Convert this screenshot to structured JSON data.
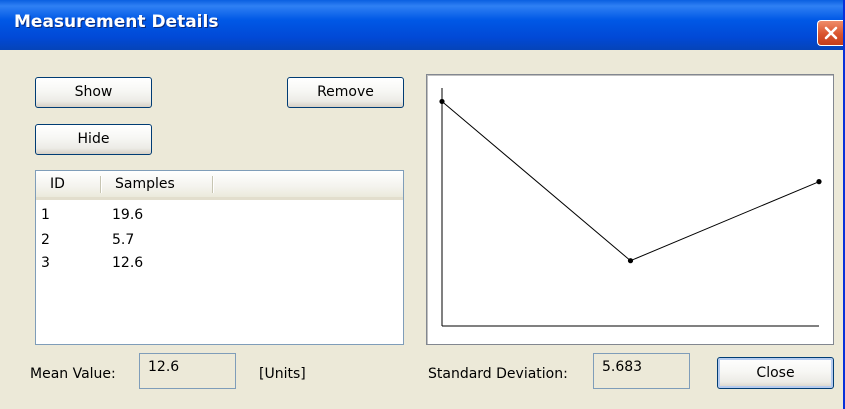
{
  "window": {
    "title": "Measurement Details"
  },
  "buttons": {
    "show": "Show",
    "remove": "Remove",
    "hide": "Hide",
    "close": "Close"
  },
  "table": {
    "columns": [
      "ID",
      "Samples"
    ],
    "rows": [
      {
        "id": "1",
        "sample": "19.6"
      },
      {
        "id": "2",
        "sample": "5.7"
      },
      {
        "id": "3",
        "sample": "12.6"
      }
    ]
  },
  "stats": {
    "mean_label": "Mean Value:",
    "mean_value": "12.6",
    "units_label": "[Units]",
    "std_label": "Standard Deviation:",
    "std_value": "5.683"
  },
  "chart_data": {
    "type": "line",
    "x": [
      1,
      2,
      3
    ],
    "series": [
      {
        "values": [
          19.6,
          5.7,
          12.6
        ]
      }
    ],
    "xlim": [
      1,
      3
    ],
    "ylim": [
      0,
      20.6
    ],
    "grid": false
  },
  "colors": {
    "titlebar": "#0058e6",
    "dialog_bg": "#ece9d8",
    "close_red": "#d9542e",
    "line": "#000000"
  },
  "icons": {
    "close": "close-icon"
  }
}
